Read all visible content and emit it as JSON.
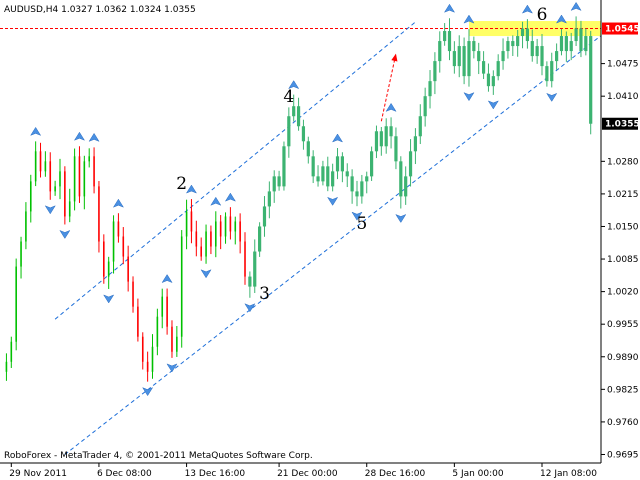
{
  "chart_data": {
    "type": "candlestick",
    "title": "AUDUSD,H4  1.0327 1.0362 1.0324 1.0355",
    "symbol": "AUDUSD,H4",
    "ohlc_header": [
      "1.0327",
      "1.0362",
      "1.0324",
      "1.0355"
    ],
    "ylim": [
      0.968,
      1.057
    ],
    "y_ticks": [
      "1.0475",
      "1.0410",
      "1.0280",
      "1.0215",
      "1.0150",
      "1.0085",
      "1.0020",
      "0.9955",
      "0.9890",
      "0.9825",
      "0.9760",
      "0.9695"
    ],
    "x_ticks": [
      "29 Nov 2011",
      "6 Dec 08:00",
      "13 Dec 16:00",
      "21 Dec 00:00",
      "28 Dec 16:00",
      "5 Jan 00:00",
      "12 Jan 08:00"
    ],
    "price_labels": [
      {
        "text": "1.0545",
        "value": 1.0545,
        "color": "#ff0000"
      },
      {
        "text": "1.0355",
        "value": 1.0355,
        "color": "#000000"
      }
    ],
    "target_level": 1.0545,
    "target_zone": [
      1.053,
      1.056
    ],
    "wave_labels": [
      {
        "text": "2",
        "bar": 36,
        "price": 1.0225
      },
      {
        "text": "3",
        "bar": 53,
        "price": 1.0005
      },
      {
        "text": "4",
        "bar": 58,
        "price": 1.0398
      },
      {
        "text": "5",
        "bar": 73,
        "price": 1.0145
      },
      {
        "text": "6",
        "bar": 110,
        "price": 1.0562
      }
    ],
    "channel_lines": [
      {
        "from": [
          10,
          0.9965
        ],
        "to": [
          84,
          1.0558
        ]
      },
      {
        "from": [
          12,
          0.9695
        ],
        "to": [
          122,
          1.053
        ]
      }
    ],
    "forecast_arrow": {
      "from": [
        77,
        1.036
      ],
      "to": [
        80,
        1.0495
      ]
    },
    "series": [
      {
        "bull_color": "#00c000",
        "bear_color": "#ff0000",
        "highlight_color": "#3cb371",
        "highlight_from_bar": 50,
        "close": [
          0.988,
          0.992,
          1.007,
          1.012,
          1.018,
          1.024,
          1.03,
          1.026,
          1.028,
          1.022,
          1.023,
          1.026,
          1.017,
          1.02,
          1.029,
          1.021,
          1.028,
          1.029,
          1.023,
          1.012,
          1.005,
          1.008,
          1.016,
          1.013,
          1.009,
          1.004,
          0.999,
          0.993,
          0.988,
          0.986,
          0.991,
          0.997,
          1.001,
          0.995,
          0.99,
          0.993,
          1.013,
          1.018,
          1.014,
          1.011,
          1.009,
          1.014,
          1.011,
          1.016,
          1.013,
          1.017,
          1.014,
          1.016,
          1.012,
          1.005,
          1.003,
          1.01,
          1.015,
          1.019,
          1.022,
          1.025,
          1.023,
          1.031,
          1.037,
          1.039,
          1.035,
          1.032,
          1.029,
          1.025,
          1.024,
          1.027,
          1.023,
          1.026,
          1.029,
          1.026,
          1.025,
          1.022,
          1.021,
          1.024,
          1.025,
          1.03,
          1.034,
          1.031,
          1.035,
          1.033,
          1.028,
          1.021,
          1.025,
          1.03,
          1.033,
          1.037,
          1.041,
          1.044,
          1.048,
          1.052,
          1.054,
          1.05,
          1.047,
          1.051,
          1.045,
          1.052,
          1.05,
          1.048,
          1.0455,
          1.043,
          1.045,
          1.048,
          1.05,
          1.052,
          1.051,
          1.053,
          1.0545,
          1.052,
          1.049,
          1.051,
          1.047,
          1.044,
          1.048,
          1.05,
          1.053,
          1.05,
          1.052,
          1.0545,
          1.05,
          1.053,
          1.0355
        ]
      }
    ]
  },
  "watermark": "RoboForex - MetaTrader 4, © 2001-2011 MetaQuotes Software Corp.",
  "colors": {
    "background": "#ffffff",
    "axis": "#000000",
    "channel": "#1e6fd9",
    "fractal": "#4a90e2",
    "target_zone": "#ffff66",
    "target_line": "#ff0000"
  }
}
